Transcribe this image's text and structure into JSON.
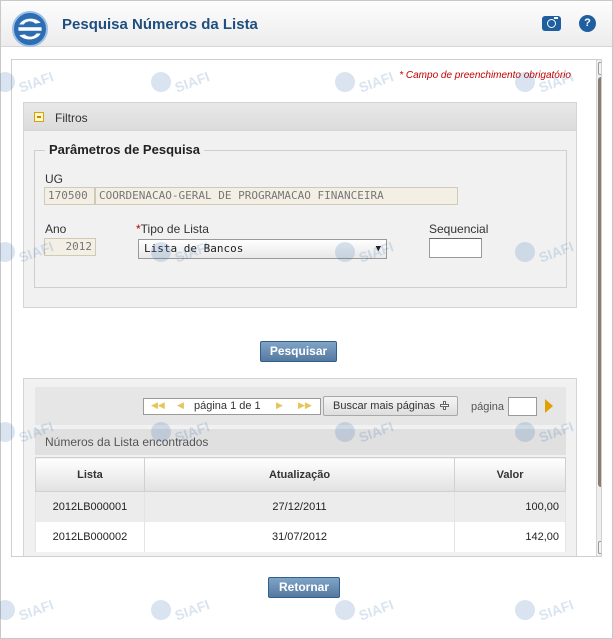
{
  "header": {
    "title": "Pesquisa Números da Lista",
    "help_label": "?"
  },
  "form": {
    "required_note": "* Campo de preenchimento obrigatório",
    "filters_title": "Filtros",
    "params_legend": "Parâmetros de Pesquisa",
    "ug_label": "UG",
    "ug_code": "170500",
    "ug_name": "COORDENACAO-GERAL DE PROGRAMACAO FINANCEIRA",
    "ano_label": "Ano",
    "ano_value": "2012",
    "tipo_label": "Tipo de Lista",
    "tipo_required_mark": "*",
    "tipo_value": "Lista de Bancos",
    "sequencial_label": "Sequencial",
    "sequencial_value": ""
  },
  "actions": {
    "search_label": "Pesquisar",
    "return_label": "Retornar"
  },
  "pager": {
    "first": "◀◀",
    "prev": "◀",
    "text": "página 1 de 1",
    "next": "▶",
    "last": "▶▶",
    "more_label": "Buscar mais páginas",
    "page_label": "página",
    "page_value": ""
  },
  "results": {
    "title": "Números da Lista encontrados",
    "columns": [
      "Lista",
      "Atualização",
      "Valor"
    ],
    "rows": [
      [
        "2012LB000001",
        "27/12/2011",
        "100,00"
      ],
      [
        "2012LB000002",
        "31/07/2012",
        "142,00"
      ]
    ]
  },
  "watermark": "SIAFI"
}
